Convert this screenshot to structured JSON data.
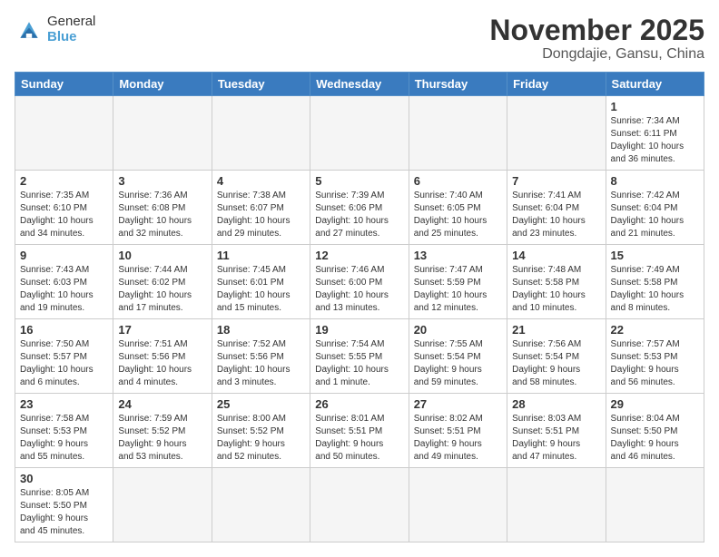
{
  "header": {
    "logo_general": "General",
    "logo_blue": "Blue",
    "month_title": "November 2025",
    "location": "Dongdajie, Gansu, China"
  },
  "weekdays": [
    "Sunday",
    "Monday",
    "Tuesday",
    "Wednesday",
    "Thursday",
    "Friday",
    "Saturday"
  ],
  "weeks": [
    [
      {
        "day": "",
        "info": ""
      },
      {
        "day": "",
        "info": ""
      },
      {
        "day": "",
        "info": ""
      },
      {
        "day": "",
        "info": ""
      },
      {
        "day": "",
        "info": ""
      },
      {
        "day": "",
        "info": ""
      },
      {
        "day": "1",
        "info": "Sunrise: 7:34 AM\nSunset: 6:11 PM\nDaylight: 10 hours\nand 36 minutes."
      }
    ],
    [
      {
        "day": "2",
        "info": "Sunrise: 7:35 AM\nSunset: 6:10 PM\nDaylight: 10 hours\nand 34 minutes."
      },
      {
        "day": "3",
        "info": "Sunrise: 7:36 AM\nSunset: 6:08 PM\nDaylight: 10 hours\nand 32 minutes."
      },
      {
        "day": "4",
        "info": "Sunrise: 7:38 AM\nSunset: 6:07 PM\nDaylight: 10 hours\nand 29 minutes."
      },
      {
        "day": "5",
        "info": "Sunrise: 7:39 AM\nSunset: 6:06 PM\nDaylight: 10 hours\nand 27 minutes."
      },
      {
        "day": "6",
        "info": "Sunrise: 7:40 AM\nSunset: 6:05 PM\nDaylight: 10 hours\nand 25 minutes."
      },
      {
        "day": "7",
        "info": "Sunrise: 7:41 AM\nSunset: 6:04 PM\nDaylight: 10 hours\nand 23 minutes."
      },
      {
        "day": "8",
        "info": "Sunrise: 7:42 AM\nSunset: 6:04 PM\nDaylight: 10 hours\nand 21 minutes."
      }
    ],
    [
      {
        "day": "9",
        "info": "Sunrise: 7:43 AM\nSunset: 6:03 PM\nDaylight: 10 hours\nand 19 minutes."
      },
      {
        "day": "10",
        "info": "Sunrise: 7:44 AM\nSunset: 6:02 PM\nDaylight: 10 hours\nand 17 minutes."
      },
      {
        "day": "11",
        "info": "Sunrise: 7:45 AM\nSunset: 6:01 PM\nDaylight: 10 hours\nand 15 minutes."
      },
      {
        "day": "12",
        "info": "Sunrise: 7:46 AM\nSunset: 6:00 PM\nDaylight: 10 hours\nand 13 minutes."
      },
      {
        "day": "13",
        "info": "Sunrise: 7:47 AM\nSunset: 5:59 PM\nDaylight: 10 hours\nand 12 minutes."
      },
      {
        "day": "14",
        "info": "Sunrise: 7:48 AM\nSunset: 5:58 PM\nDaylight: 10 hours\nand 10 minutes."
      },
      {
        "day": "15",
        "info": "Sunrise: 7:49 AM\nSunset: 5:58 PM\nDaylight: 10 hours\nand 8 minutes."
      }
    ],
    [
      {
        "day": "16",
        "info": "Sunrise: 7:50 AM\nSunset: 5:57 PM\nDaylight: 10 hours\nand 6 minutes."
      },
      {
        "day": "17",
        "info": "Sunrise: 7:51 AM\nSunset: 5:56 PM\nDaylight: 10 hours\nand 4 minutes."
      },
      {
        "day": "18",
        "info": "Sunrise: 7:52 AM\nSunset: 5:56 PM\nDaylight: 10 hours\nand 3 minutes."
      },
      {
        "day": "19",
        "info": "Sunrise: 7:54 AM\nSunset: 5:55 PM\nDaylight: 10 hours\nand 1 minute."
      },
      {
        "day": "20",
        "info": "Sunrise: 7:55 AM\nSunset: 5:54 PM\nDaylight: 9 hours\nand 59 minutes."
      },
      {
        "day": "21",
        "info": "Sunrise: 7:56 AM\nSunset: 5:54 PM\nDaylight: 9 hours\nand 58 minutes."
      },
      {
        "day": "22",
        "info": "Sunrise: 7:57 AM\nSunset: 5:53 PM\nDaylight: 9 hours\nand 56 minutes."
      }
    ],
    [
      {
        "day": "23",
        "info": "Sunrise: 7:58 AM\nSunset: 5:53 PM\nDaylight: 9 hours\nand 55 minutes."
      },
      {
        "day": "24",
        "info": "Sunrise: 7:59 AM\nSunset: 5:52 PM\nDaylight: 9 hours\nand 53 minutes."
      },
      {
        "day": "25",
        "info": "Sunrise: 8:00 AM\nSunset: 5:52 PM\nDaylight: 9 hours\nand 52 minutes."
      },
      {
        "day": "26",
        "info": "Sunrise: 8:01 AM\nSunset: 5:51 PM\nDaylight: 9 hours\nand 50 minutes."
      },
      {
        "day": "27",
        "info": "Sunrise: 8:02 AM\nSunset: 5:51 PM\nDaylight: 9 hours\nand 49 minutes."
      },
      {
        "day": "28",
        "info": "Sunrise: 8:03 AM\nSunset: 5:51 PM\nDaylight: 9 hours\nand 47 minutes."
      },
      {
        "day": "29",
        "info": "Sunrise: 8:04 AM\nSunset: 5:50 PM\nDaylight: 9 hours\nand 46 minutes."
      }
    ],
    [
      {
        "day": "30",
        "info": "Sunrise: 8:05 AM\nSunset: 5:50 PM\nDaylight: 9 hours\nand 45 minutes."
      },
      {
        "day": "",
        "info": ""
      },
      {
        "day": "",
        "info": ""
      },
      {
        "day": "",
        "info": ""
      },
      {
        "day": "",
        "info": ""
      },
      {
        "day": "",
        "info": ""
      },
      {
        "day": "",
        "info": ""
      }
    ]
  ]
}
